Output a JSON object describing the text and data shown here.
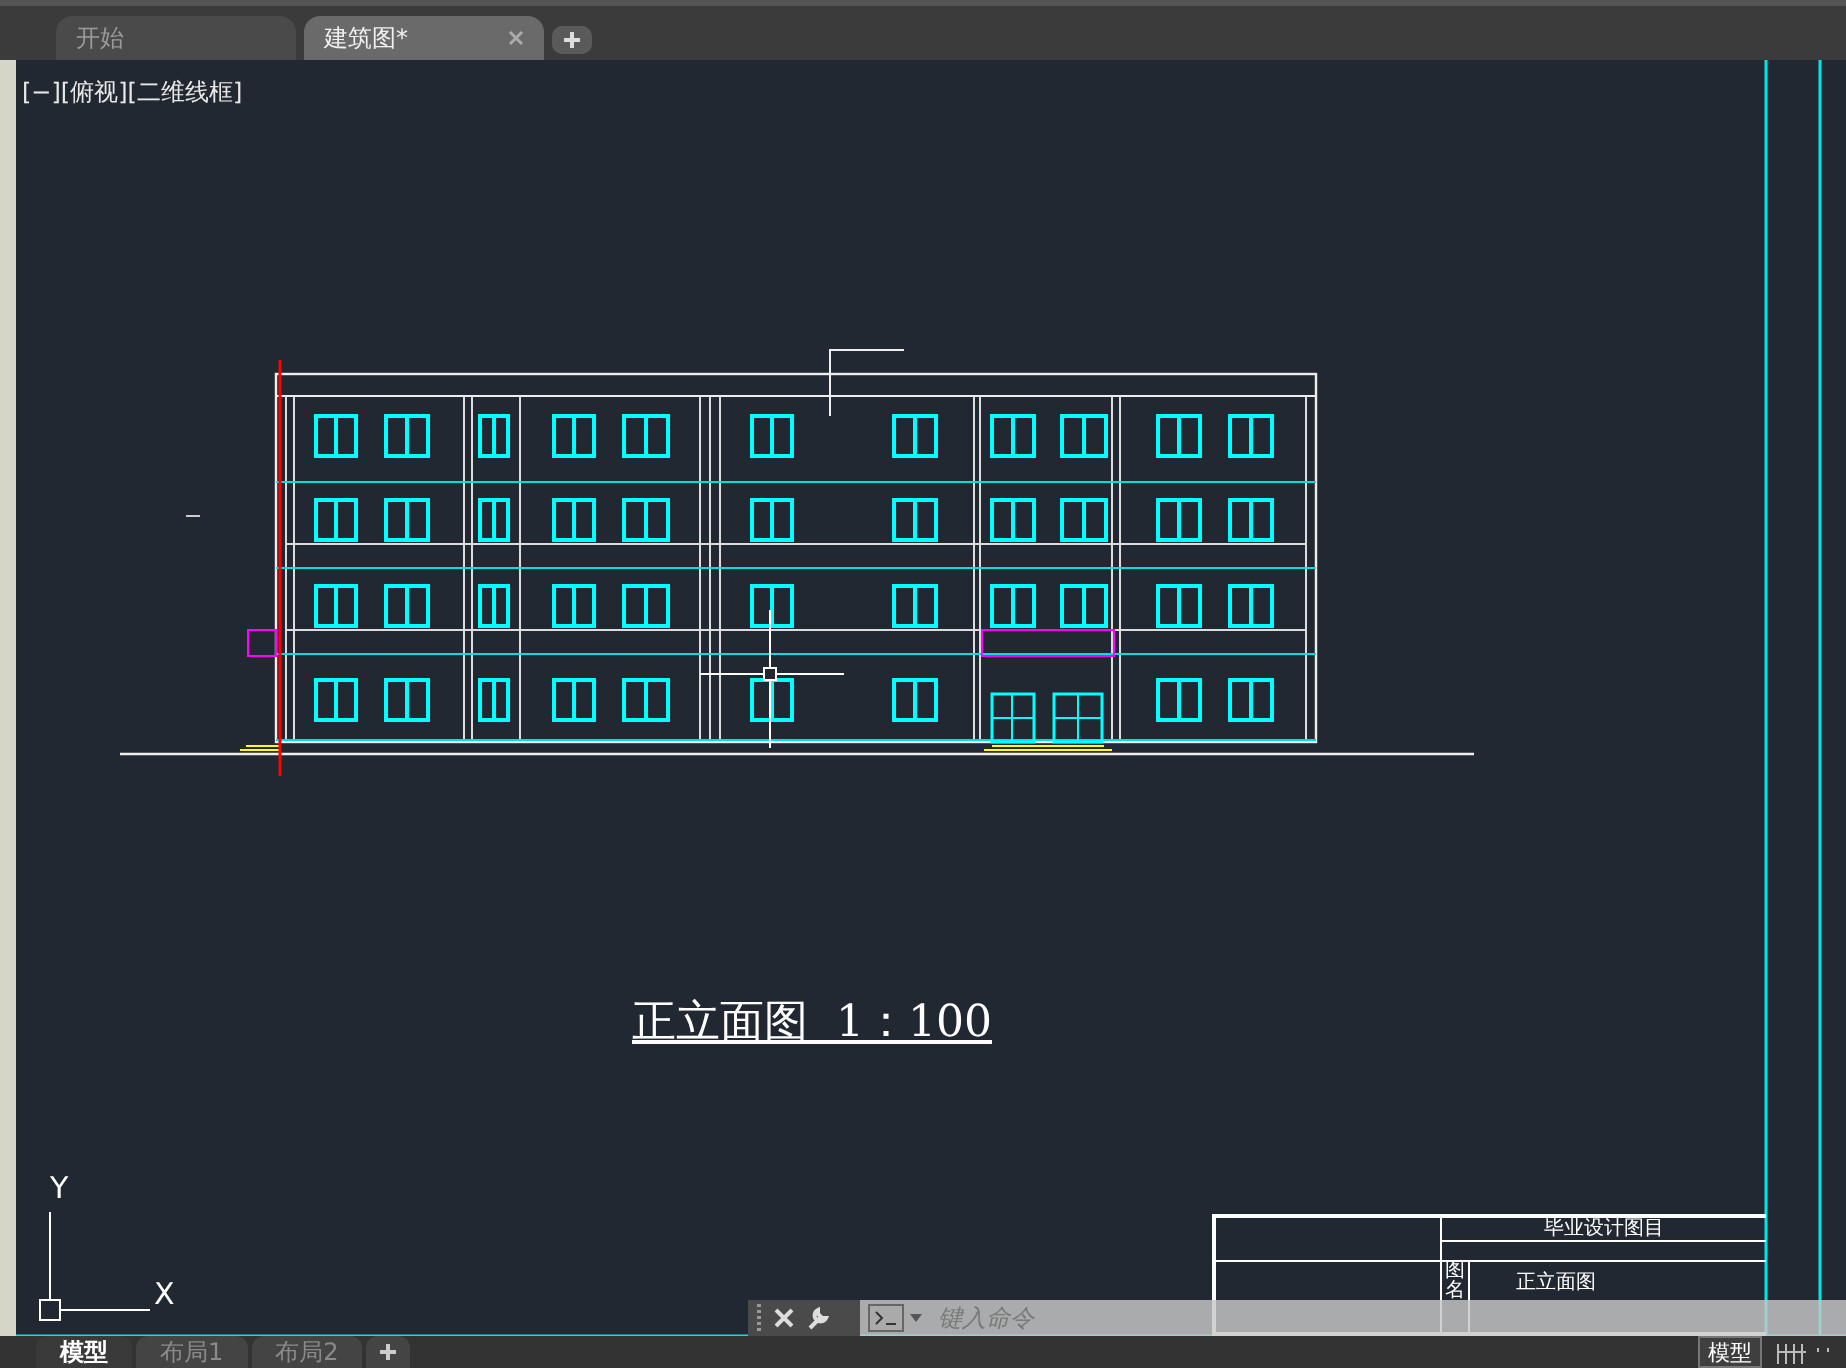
{
  "file_tabs": [
    {
      "label": "开始",
      "selected": false,
      "closable": false
    },
    {
      "label": "建筑图*",
      "selected": true,
      "closable": true
    }
  ],
  "viewport": {
    "label": "[−][俯视][二维线框]",
    "drawing_title": "正立面图  1：100",
    "ucs": {
      "y_label": "Y",
      "x_label": "X"
    },
    "title_block": {
      "header": "毕业设计图目",
      "name_label": "图名",
      "name": "正立面图"
    }
  },
  "command_line": {
    "placeholder": "键入命令"
  },
  "layout_tabs": [
    {
      "label": "模型",
      "selected": true
    },
    {
      "label": "布局1",
      "selected": false
    },
    {
      "label": "布局2",
      "selected": false
    }
  ],
  "status_bar": {
    "model_button": "模型"
  }
}
